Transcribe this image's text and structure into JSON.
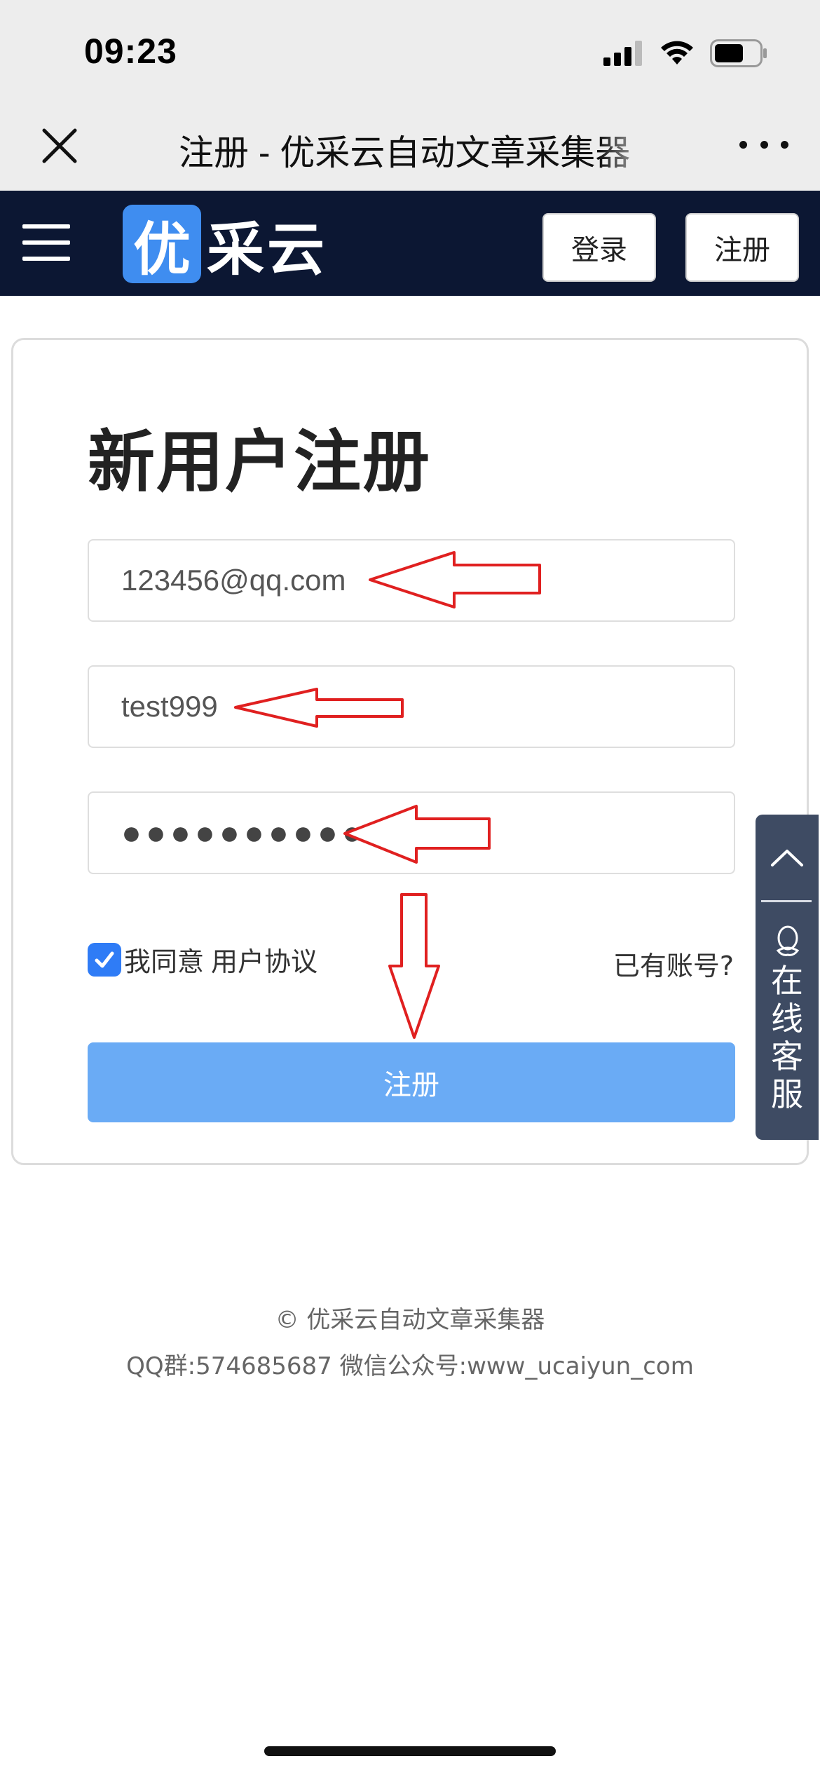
{
  "status_bar": {
    "time": "09:23",
    "icons": [
      "signal-icon",
      "wifi-icon",
      "battery-icon"
    ]
  },
  "title_bar": {
    "title": "注册 - 优采云自动文章采集器"
  },
  "nav": {
    "logo_first_char": "优",
    "logo_rest": "采云",
    "login_label": "登录",
    "register_label": "注册"
  },
  "form": {
    "heading": "新用户注册",
    "email_value": "123456@qq.com",
    "username_value": "test999",
    "password_masked": "●●●●●●●●●●●",
    "agree_checked": true,
    "agree_text": "我同意",
    "agreement_link": "用户协议",
    "have_account": "已有账号?",
    "submit_label": "注册"
  },
  "side_service": {
    "label": "在线客服",
    "chars": [
      "在",
      "线",
      "客",
      "服"
    ]
  },
  "footer": {
    "line1": "© 优采云自动文章采集器",
    "line2": "QQ群:574685687 微信公众号:www_ucaiyun_com"
  },
  "colors": {
    "nav_bg": "#0c1733",
    "logo_blue": "#3f8df0",
    "submit_bg": "#6aabf5",
    "checkbox": "#2f7cf6",
    "annotation_red": "#e02020",
    "side_bg": "#3e4b63"
  }
}
